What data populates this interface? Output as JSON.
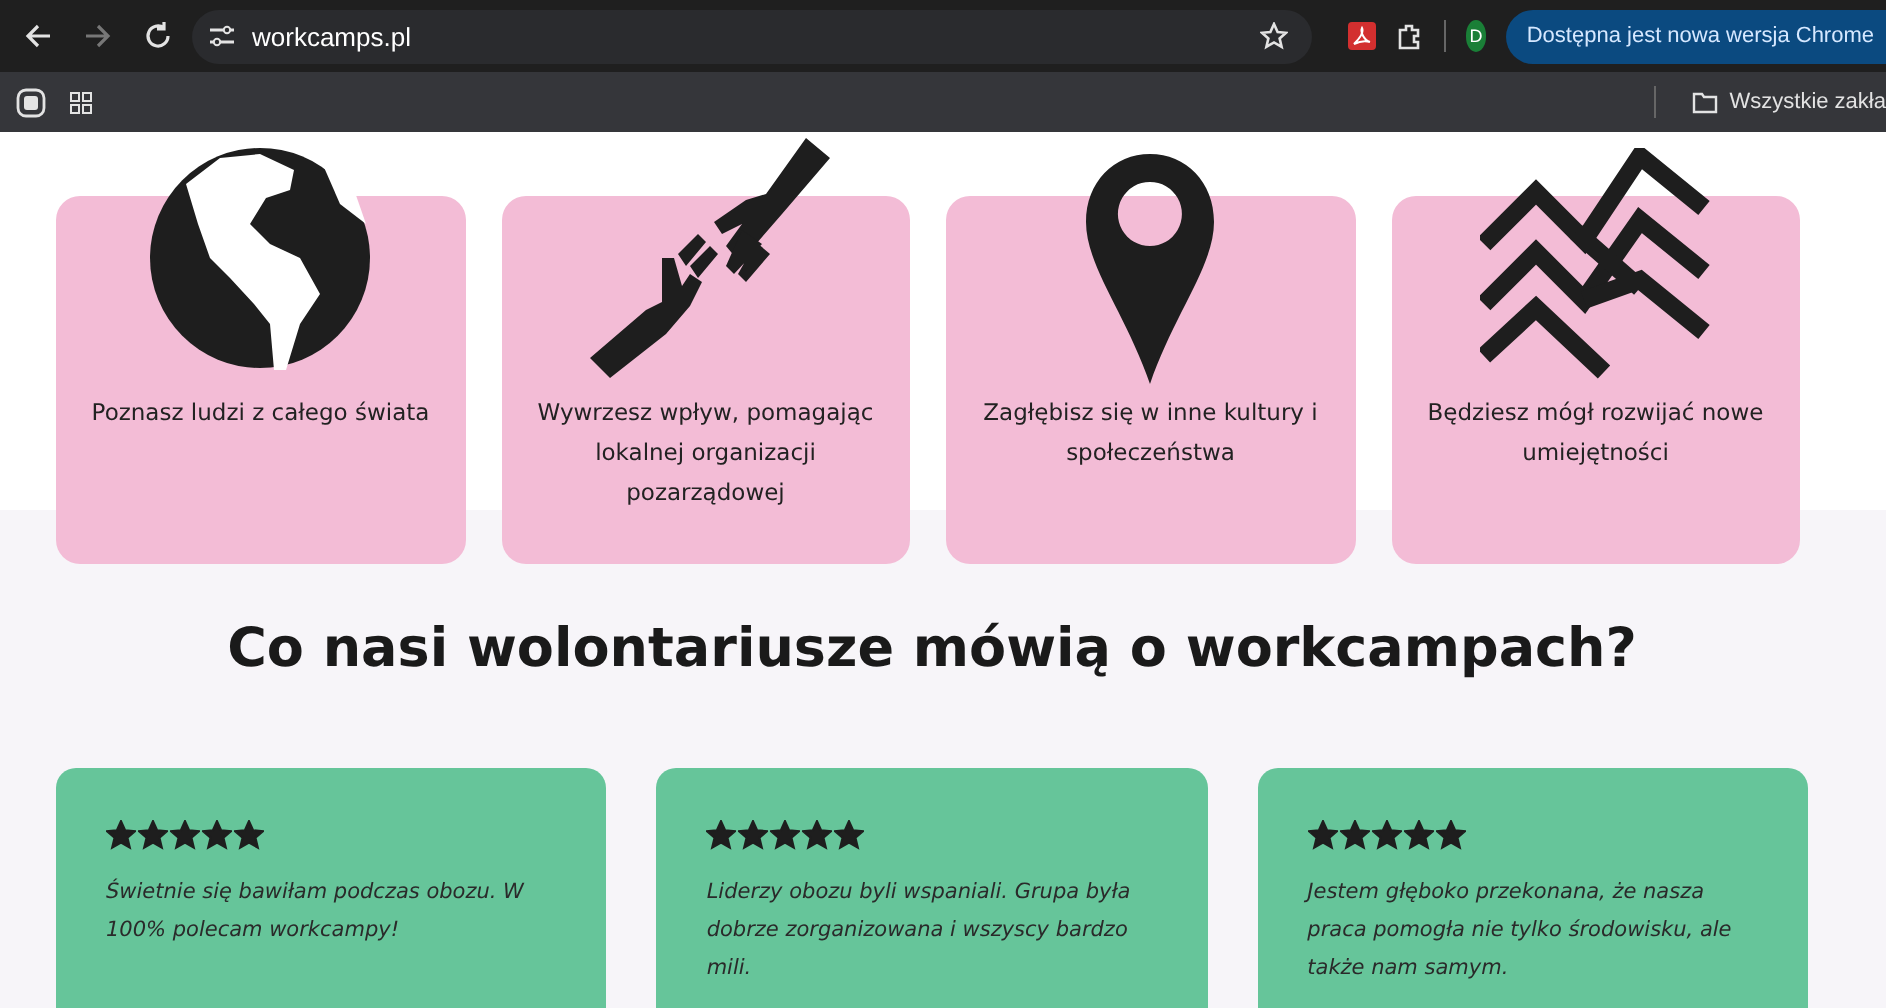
{
  "browser": {
    "url": "workcamps.pl",
    "update_button": "Dostępna jest nowa wersja Chrome",
    "profile_initial": "D",
    "bookmarks_folder": "Wszystkie zakła"
  },
  "features": [
    {
      "text": "Poznasz ludzi z całego świata"
    },
    {
      "text": "Wywrzesz wpływ, pomagając lokalnej organizacji pozarządowej"
    },
    {
      "text": "Zagłębisz się w inne kultury i społeczeństwa"
    },
    {
      "text": "Będziesz mógł rozwijać nowe umiejętności"
    }
  ],
  "heading": "Co nasi wolontariusze mówią o workcampach?",
  "reviews": [
    {
      "stars": 5,
      "text": "Świetnie się bawiłam podczas obozu. W 100% polecam workcampy!"
    },
    {
      "stars": 5,
      "text": "Liderzy obozu byli wspaniali. Grupa była dobrze zorganizowana i wszyscy bardzo mili."
    },
    {
      "stars": 5,
      "text": "Jestem głęboko przekonana, że nasza praca pomogła nie tylko środowisku, ale także nam samym."
    }
  ]
}
